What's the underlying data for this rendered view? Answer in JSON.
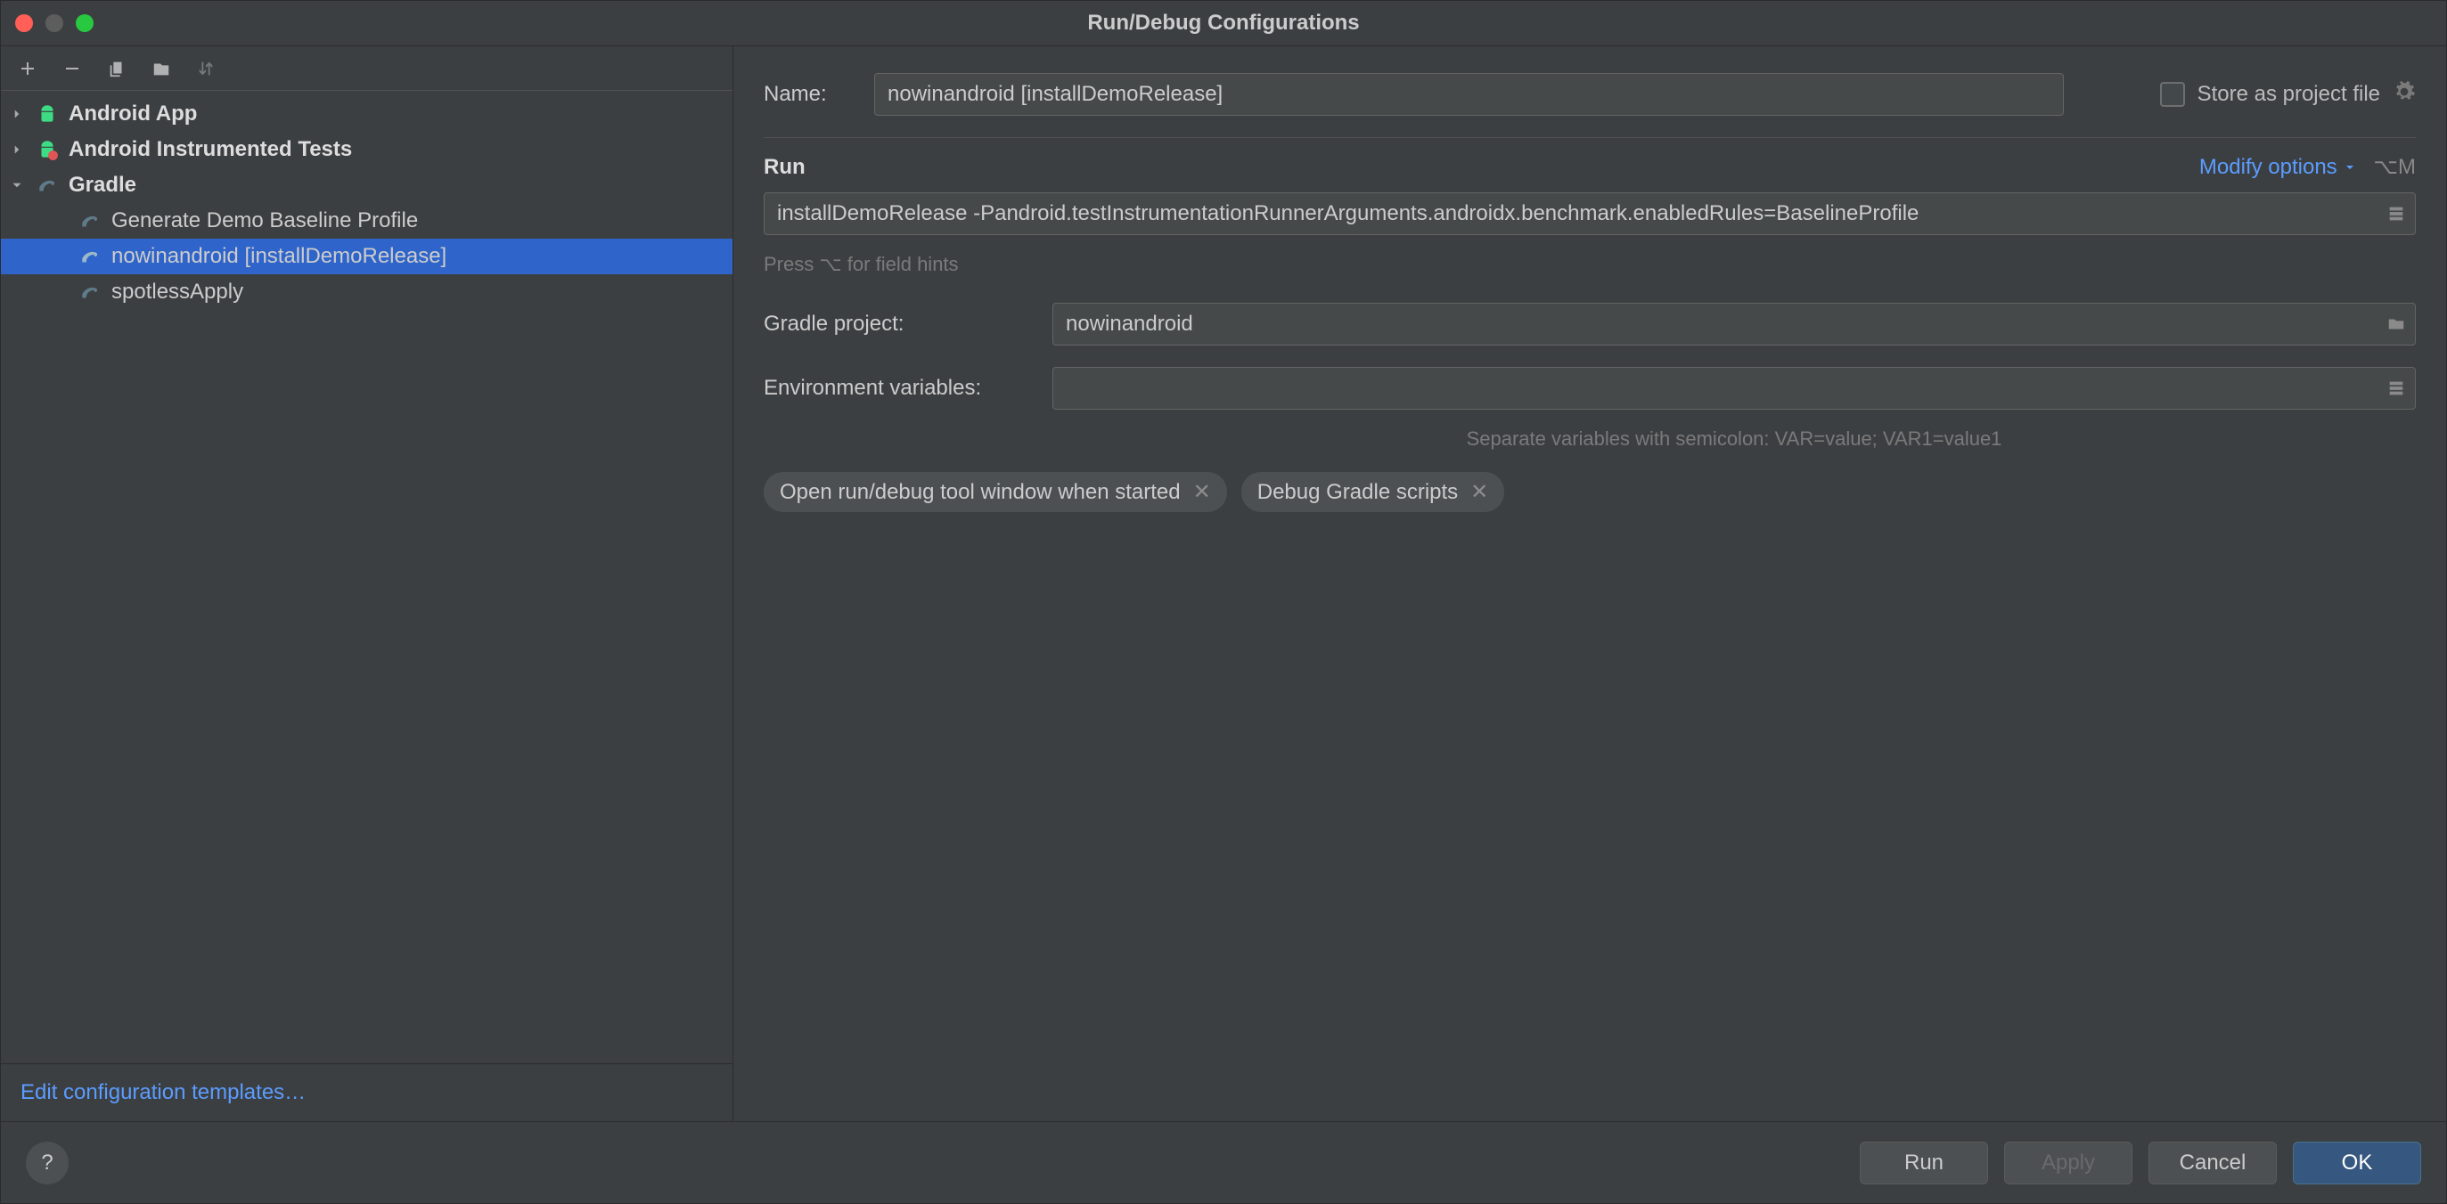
{
  "window": {
    "title": "Run/Debug Configurations"
  },
  "toolbar": {
    "add": "Add",
    "remove": "Remove",
    "copy": "Copy",
    "save": "Save",
    "sort": "Sort"
  },
  "tree": {
    "android_app": "Android App",
    "android_tests": "Android Instrumented Tests",
    "gradle": "Gradle",
    "items": [
      {
        "label": "Generate Demo Baseline Profile"
      },
      {
        "label": "nowinandroid [installDemoRelease]"
      },
      {
        "label": "spotlessApply"
      }
    ]
  },
  "sidebar": {
    "edit_templates": "Edit configuration templates…"
  },
  "form": {
    "name_label": "Name:",
    "name_value": "nowinandroid [installDemoRelease]",
    "store_label": "Store as project file",
    "run_section": "Run",
    "modify_options": "Modify options",
    "modify_shortcut": "⌥M",
    "run_command": "installDemoRelease -Pandroid.testInstrumentationRunnerArguments.androidx.benchmark.enabledRules=BaselineProfile",
    "run_hint": "Press ⌥ for field hints",
    "gradle_project_label": "Gradle project:",
    "gradle_project_value": "nowinandroid",
    "env_label": "Environment variables:",
    "env_value": "",
    "env_hint": "Separate variables with semicolon: VAR=value; VAR1=value1",
    "chip_open": "Open run/debug tool window when started",
    "chip_debug": "Debug Gradle scripts"
  },
  "footer": {
    "run": "Run",
    "apply": "Apply",
    "cancel": "Cancel",
    "ok": "OK"
  }
}
